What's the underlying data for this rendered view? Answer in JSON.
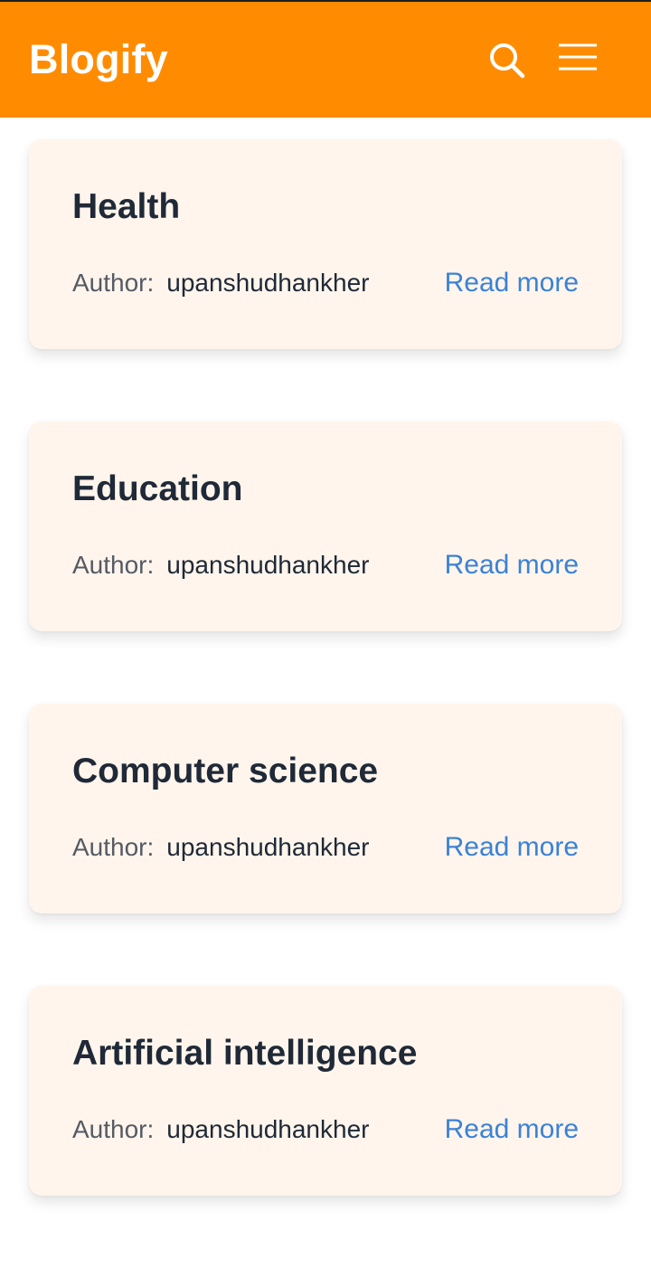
{
  "header": {
    "brand": "Blogify",
    "background_color": "#ff8c00",
    "search_icon": "search-icon",
    "menu_icon": "hamburger-menu-icon"
  },
  "posts": [
    {
      "title": "Health",
      "author_label": "Author:",
      "author": "upanshudhankher",
      "link_label": "Read more"
    },
    {
      "title": "Education",
      "author_label": "Author:",
      "author": "upanshudhankher",
      "link_label": "Read more"
    },
    {
      "title": "Computer science",
      "author_label": "Author:",
      "author": "upanshudhankher",
      "link_label": "Read more"
    },
    {
      "title": "Artificial intelligence",
      "author_label": "Author:",
      "author": "upanshudhankher",
      "link_label": "Read more"
    }
  ],
  "colors": {
    "card_background": "#fff5ec",
    "title": "#1f2937",
    "link": "#3b82d6"
  }
}
